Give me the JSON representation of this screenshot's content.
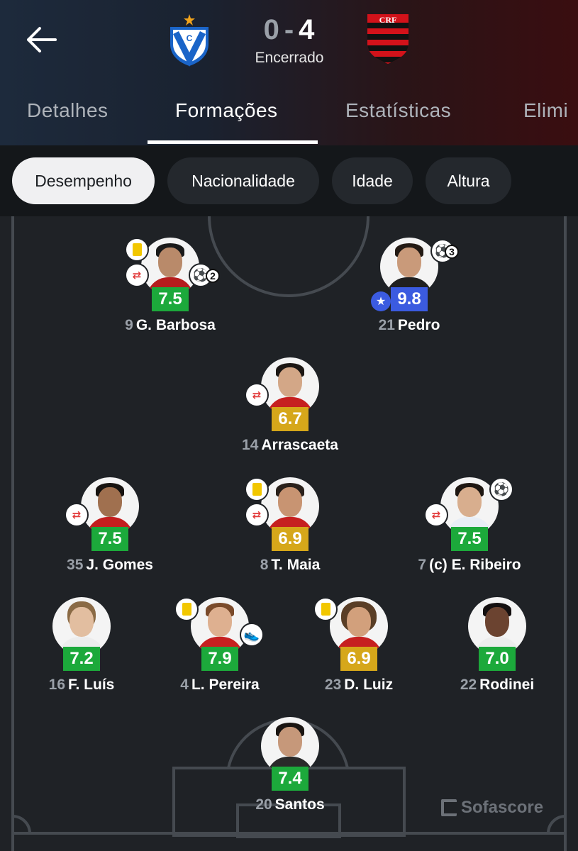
{
  "match": {
    "home_score": "0",
    "away_score": "4",
    "separator": "-",
    "status": "Encerrado",
    "home_crest_icon": "velez-sarsfield-crest",
    "away_crest_icon": "flamengo-crest"
  },
  "tabs": [
    {
      "label": "Detalhes",
      "active": false
    },
    {
      "label": "Formações",
      "active": true
    },
    {
      "label": "Estatísticas",
      "active": false
    },
    {
      "label": "Elimi",
      "active": false
    }
  ],
  "filters": [
    {
      "label": "Desempenho",
      "active": true
    },
    {
      "label": "Nacionalidade",
      "active": false
    },
    {
      "label": "Idade",
      "active": false
    },
    {
      "label": "Altura",
      "active": false
    }
  ],
  "colors": {
    "rating_green": "#1ca93b",
    "rating_yellow": "#d6a71a",
    "rating_blue": "#3b5be0",
    "pitch": "#1f2226"
  },
  "players": [
    {
      "number": "9",
      "name": "G. Barbosa",
      "rating": "7.5",
      "rating_color": "green",
      "yellow_card": true,
      "subbed": true,
      "goals": "2",
      "assists": "",
      "motm": false
    },
    {
      "number": "21",
      "name": "Pedro",
      "rating": "9.8",
      "rating_color": "blue",
      "yellow_card": false,
      "subbed": false,
      "goals": "3",
      "assists": "",
      "motm": true
    },
    {
      "number": "14",
      "name": "Arrascaeta",
      "rating": "6.7",
      "rating_color": "yellow",
      "yellow_card": false,
      "subbed": true,
      "goals": "",
      "assists": "",
      "motm": false
    },
    {
      "number": "35",
      "name": "J. Gomes",
      "rating": "7.5",
      "rating_color": "green",
      "yellow_card": false,
      "subbed": true,
      "goals": "",
      "assists": "",
      "motm": false
    },
    {
      "number": "8",
      "name": "T. Maia",
      "rating": "6.9",
      "rating_color": "yellow",
      "yellow_card": true,
      "subbed": true,
      "goals": "",
      "assists": "",
      "motm": false
    },
    {
      "number": "7",
      "name": "(c) E. Ribeiro",
      "rating": "7.5",
      "rating_color": "green",
      "yellow_card": false,
      "subbed": true,
      "goals": "1",
      "assists": "",
      "motm": false
    },
    {
      "number": "16",
      "name": "F. Luís",
      "rating": "7.2",
      "rating_color": "green",
      "yellow_card": false,
      "subbed": false,
      "goals": "",
      "assists": "",
      "motm": false
    },
    {
      "number": "4",
      "name": "L. Pereira",
      "rating": "7.9",
      "rating_color": "green",
      "yellow_card": true,
      "subbed": false,
      "goals": "",
      "assists": "1",
      "motm": false
    },
    {
      "number": "23",
      "name": "D. Luiz",
      "rating": "6.9",
      "rating_color": "yellow",
      "yellow_card": true,
      "subbed": false,
      "goals": "",
      "assists": "",
      "motm": false
    },
    {
      "number": "22",
      "name": "Rodinei",
      "rating": "7.0",
      "rating_color": "green",
      "yellow_card": false,
      "subbed": false,
      "goals": "",
      "assists": "",
      "motm": false
    },
    {
      "number": "20",
      "name": "Santos",
      "rating": "7.4",
      "rating_color": "green",
      "yellow_card": false,
      "subbed": false,
      "goals": "",
      "assists": "",
      "motm": false
    }
  ],
  "watermark": "Sofascore"
}
